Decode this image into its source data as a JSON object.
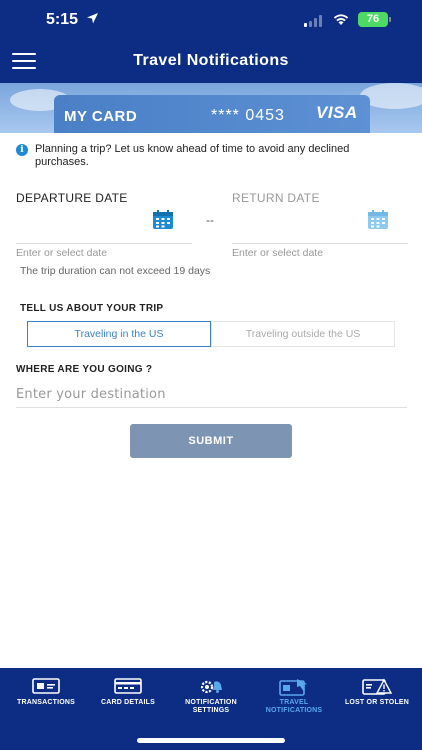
{
  "status": {
    "time": "5:15",
    "battery": "76"
  },
  "header": {
    "title": "Travel Notifications"
  },
  "card": {
    "name": "MY CARD",
    "number": "**** 0453",
    "brand": "VISA"
  },
  "info": {
    "text": "Planning a trip? Let us know ahead of time to avoid any declined purchases."
  },
  "dates": {
    "departure_label": "DEPARTURE DATE",
    "return_label": "RETURN DATE",
    "separator": "--",
    "departure_placeholder": "Enter or select date",
    "return_placeholder": "Enter or select date",
    "duration_note": "The trip duration can not exceed 19 days"
  },
  "trip": {
    "heading": "TELL US ABOUT YOUR TRIP",
    "option_us": "Traveling in the US",
    "option_abroad": "Traveling outside the US",
    "selected": "Traveling in the US"
  },
  "destination": {
    "heading": "WHERE ARE YOU GOING ?",
    "placeholder": "Enter your destination",
    "value": ""
  },
  "submit": {
    "label": "SUBMIT"
  },
  "tabs": [
    {
      "label": "TRANSACTIONS",
      "active": false
    },
    {
      "label": "CARD DETAILS",
      "active": false
    },
    {
      "label": "NOTIFICATION SETTINGS",
      "active": false
    },
    {
      "label": "TRAVEL NOTIFICATIONS",
      "active": true
    },
    {
      "label": "LOST OR STOLEN",
      "active": false
    }
  ],
  "colors": {
    "brand_navy": "#0c2d83",
    "accent_blue": "#3b82c4",
    "active_tab": "#5aa8ec",
    "submit_disabled": "#7d95b2"
  }
}
